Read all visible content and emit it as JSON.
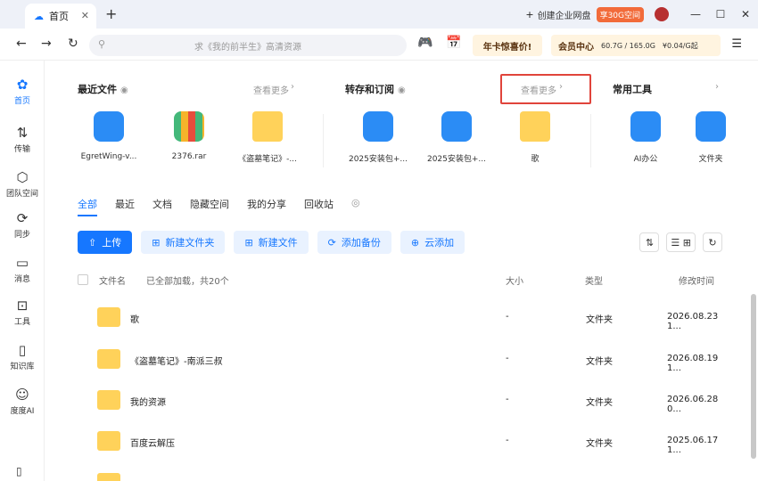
{
  "titlebar": {
    "tab_label": "首页",
    "enterprise": "创建企业网盘",
    "enterprise_badge": "享30G空间"
  },
  "navbar": {
    "search_placeholder": "求《我的前半生》高清资源",
    "promo": "年卡惊喜价!",
    "member_label": "会员中心",
    "storage": "60.7G / 165.0G",
    "price": "¥0.04/G起"
  },
  "sidebar": [
    {
      "label": "首页",
      "icon": "home-icon"
    },
    {
      "label": "传输",
      "icon": "transfer-icon"
    },
    {
      "label": "团队空间",
      "icon": "team-icon"
    },
    {
      "label": "同步",
      "icon": "sync-icon"
    },
    {
      "label": "消息",
      "icon": "message-icon"
    },
    {
      "label": "工具",
      "icon": "tools-icon"
    },
    {
      "label": "知识库",
      "icon": "knowledge-icon"
    },
    {
      "label": "度度AI",
      "icon": "ai-icon"
    }
  ],
  "recent": {
    "title": "最近文件",
    "more": "查看更多",
    "items": [
      "EgretWing-v...",
      "2376.rar",
      "《盗墓笔记》-..."
    ]
  },
  "transfer": {
    "title": "转存和订阅",
    "more": "查看更多",
    "items": [
      "2025安装包+...",
      "2025安装包+...",
      "歌"
    ]
  },
  "tools": {
    "title": "常用工具",
    "items": [
      "AI办公",
      "文件夹"
    ]
  },
  "tabs": [
    "全部",
    "最近",
    "文档",
    "隐藏空间",
    "我的分享",
    "回收站"
  ],
  "buttons": [
    "上传",
    "新建文件夹",
    "新建文件",
    "添加备份",
    "云添加"
  ],
  "table": {
    "h_name": "文件名",
    "h_status": "已全部加载，共20个",
    "h_size": "大小",
    "h_type": "类型",
    "h_time": "修改时间",
    "rows": [
      {
        "name": "歌",
        "size": "-",
        "type": "文件夹",
        "time": "2026.08.23 1..."
      },
      {
        "name": "《盗墓笔记》-南派三叔",
        "size": "-",
        "type": "文件夹",
        "time": "2026.08.19 1..."
      },
      {
        "name": "我的资源",
        "size": "-",
        "type": "文件夹",
        "time": "2026.06.28 0..."
      },
      {
        "name": "百度云解压",
        "size": "-",
        "type": "文件夹",
        "time": "2025.06.17 1..."
      }
    ]
  }
}
